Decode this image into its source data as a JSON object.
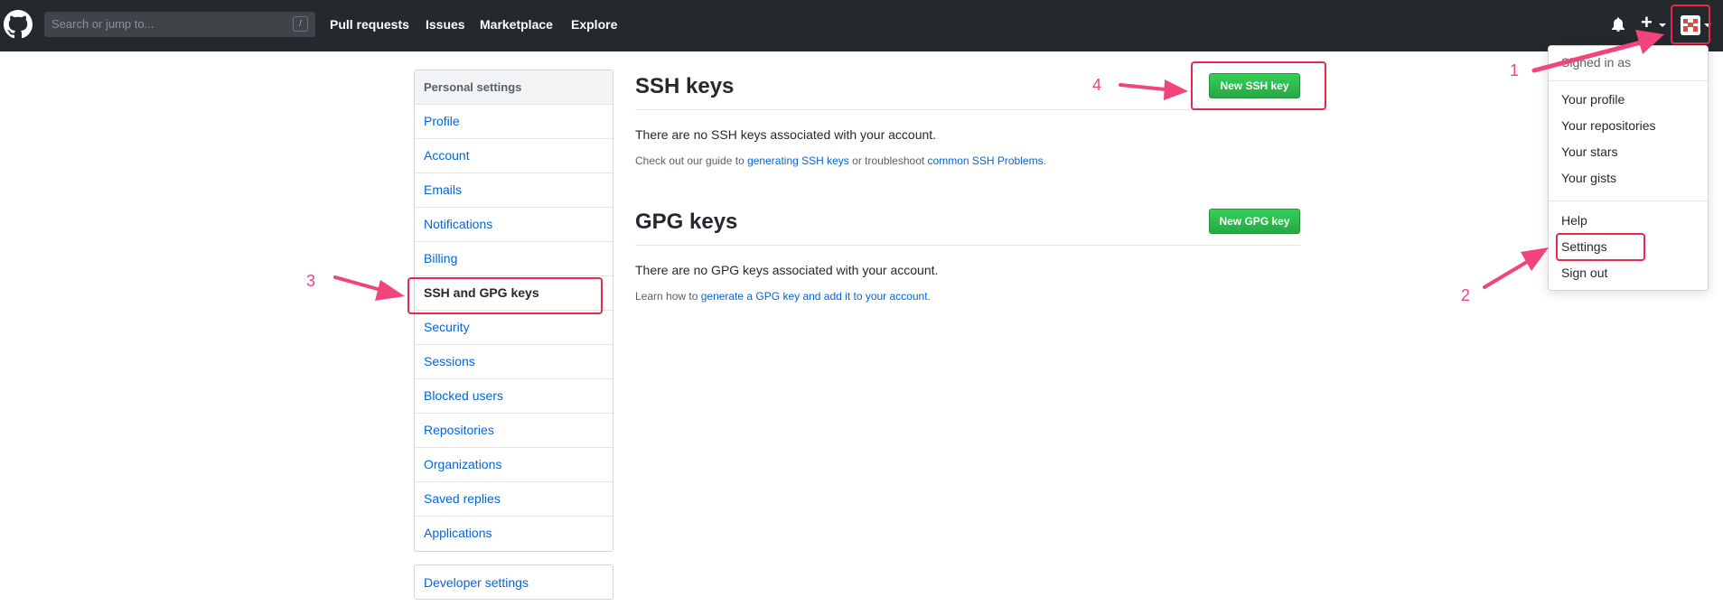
{
  "header": {
    "search_placeholder": "Search or jump to...",
    "search_shortcut": "/",
    "nav": [
      "Pull requests",
      "Issues",
      "Marketplace",
      "Explore"
    ]
  },
  "sidebar": {
    "heading": "Personal settings",
    "items": [
      "Profile",
      "Account",
      "Emails",
      "Notifications",
      "Billing",
      "SSH and GPG keys",
      "Security",
      "Sessions",
      "Blocked users",
      "Repositories",
      "Organizations",
      "Saved replies",
      "Applications"
    ],
    "selected": "SSH and GPG keys",
    "developer_settings": "Developer settings"
  },
  "ssh": {
    "title": "SSH keys",
    "button": "New SSH key",
    "empty_message": "There are no SSH keys associated with your account.",
    "guide_prefix": "Check out our guide to ",
    "guide_link": "generating SSH keys",
    "guide_middle": " or troubleshoot ",
    "guide_link2": "common SSH Problems",
    "guide_suffix": "."
  },
  "gpg": {
    "title": "GPG keys",
    "button": "New GPG key",
    "empty_message": "There are no GPG keys associated with your account.",
    "guide_prefix": "Learn how to ",
    "guide_link": "generate a GPG key and add it to your account",
    "guide_suffix": "."
  },
  "dropdown": {
    "signed_in_as": "Signed in as",
    "items1": [
      "Your profile",
      "Your repositories",
      "Your stars",
      "Your gists"
    ],
    "items2": [
      "Help",
      "Settings",
      "Sign out"
    ]
  },
  "annotations": {
    "labels": [
      "1",
      "2",
      "3",
      "4"
    ],
    "color": "#e8294b",
    "arrow_color": "#f0447a"
  },
  "colors": {
    "header_bg": "#24292e",
    "link": "#0366d6",
    "button_green": "#2ea44f"
  }
}
